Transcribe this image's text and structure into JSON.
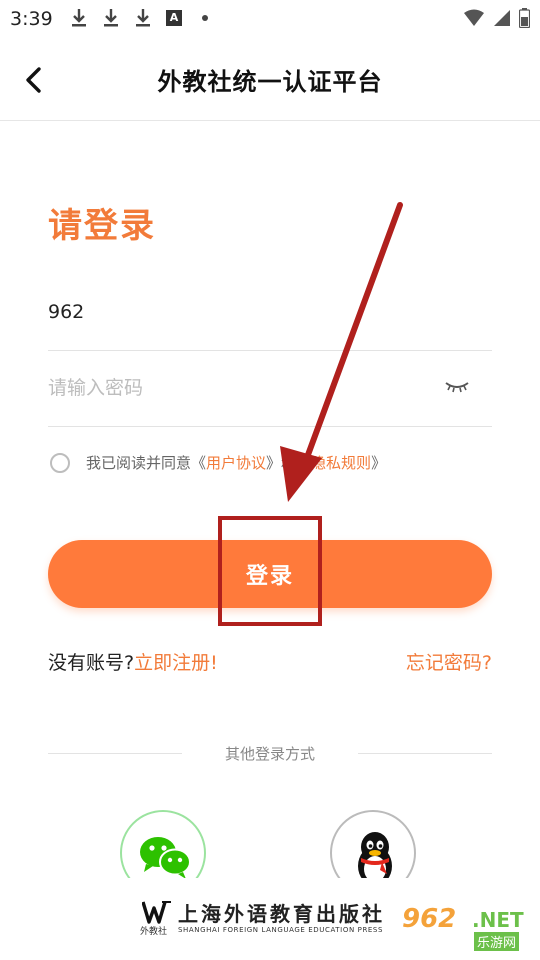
{
  "status_bar": {
    "time": "3:39",
    "extra_icon_letter": "A"
  },
  "header": {
    "title": "外教社统一认证平台"
  },
  "login": {
    "title": "请登录",
    "account_value": "962",
    "password_placeholder": "请输入密码",
    "agree_prefix": "我已阅读并同意《",
    "user_agreement": "用户协议",
    "agree_middle": "》和《",
    "privacy_rules": "隐私规则",
    "agree_suffix": "》",
    "login_button": "登录"
  },
  "links": {
    "no_account": "没有账号?",
    "register": "立即注册!",
    "forgot": "忘记密码?"
  },
  "other_login": {
    "label": "其他登录方式"
  },
  "footer": {
    "publisher_cn": "上海外语教育出版社",
    "publisher_en": "SHANGHAI FOREIGN LANGUAGE EDUCATION PRESS",
    "logo_sub": "外教社"
  },
  "watermark": {
    "number": "962",
    "net": ".NET",
    "cn": "乐游网"
  },
  "colors": {
    "accent": "#ff7a3b",
    "link": "#f27b3a",
    "annotation": "#b0201d"
  }
}
